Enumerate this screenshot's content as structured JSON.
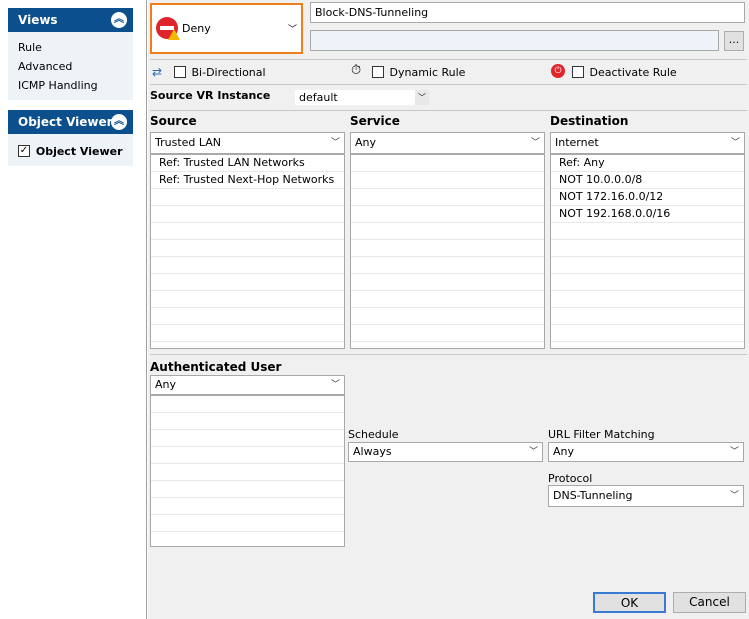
{
  "sidebar": {
    "views": {
      "title": "Views",
      "items": [
        "Rule",
        "Advanced",
        "ICMP Handling"
      ]
    },
    "object_viewer": {
      "title": "Object Viewer",
      "checkbox_label": "Object Viewer"
    }
  },
  "rule": {
    "action": "Deny",
    "name": "Block-DNS-Tunneling",
    "description": "",
    "more_button": "...",
    "bidirectional_label": "Bi-Directional",
    "dynamic_label": "Dynamic Rule",
    "deactivate_label": "Deactivate Rule",
    "vr_label": "Source VR Instance",
    "vr_value": "default"
  },
  "source": {
    "header": "Source",
    "selected": "Trusted  LAN",
    "items": [
      "Ref: Trusted LAN Networks",
      "Ref: Trusted Next-Hop Networks"
    ]
  },
  "service": {
    "header": "Service",
    "selected": "Any",
    "items": []
  },
  "destination": {
    "header": "Destination",
    "selected": "Internet",
    "items": [
      "Ref: Any",
      "NOT 10.0.0.0/8",
      "NOT 172.16.0.0/12",
      "NOT 192.168.0.0/16"
    ]
  },
  "auth_user": {
    "header": "Authenticated User",
    "selected": "Any"
  },
  "schedule": {
    "label": "Schedule",
    "value": "Always"
  },
  "url_filter": {
    "label": "URL Filter Matching",
    "value": "Any"
  },
  "protocol": {
    "label": "Protocol",
    "value": "DNS-Tunneling"
  },
  "buttons": {
    "ok": "OK",
    "cancel": "Cancel"
  },
  "colors": {
    "accent": "#f07f1b",
    "header_blue": "#0b4f8c",
    "deny_red": "#e0242b"
  }
}
